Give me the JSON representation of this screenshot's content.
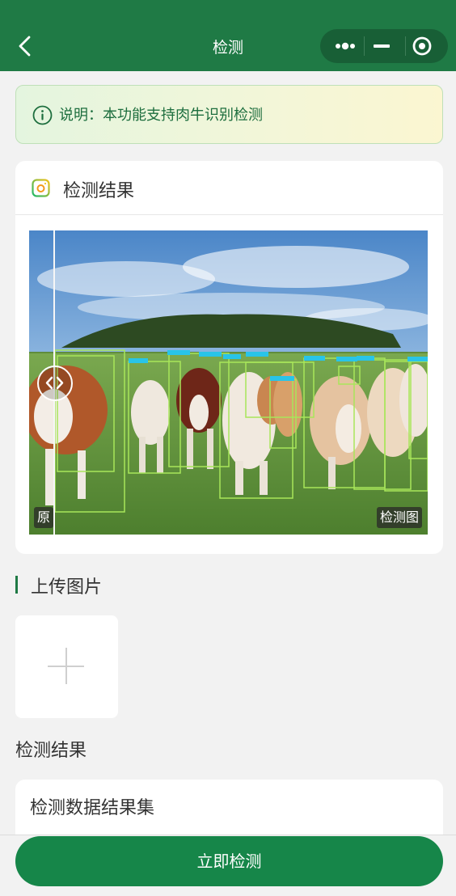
{
  "nav": {
    "title": "检测",
    "back_icon": "chevron-left-icon",
    "capsule": {
      "more_icon": "more-dots-icon",
      "minimize_icon": "minus-icon",
      "close_icon": "target-circle-icon"
    },
    "background_color": "#1f7a45"
  },
  "notice": {
    "icon": "info-circle-icon",
    "text": "说明：本功能支持肉牛识别检测"
  },
  "result": {
    "title": "检测结果",
    "icon": "camera-icon",
    "compare": {
      "original_label": "原",
      "detected_label": "检测图",
      "handle_icon": "left-right-arrows-icon"
    }
  },
  "upload": {
    "title": "上传图片",
    "add_icon": "plus-icon"
  },
  "detect_result_label": "检测结果",
  "data_card": {
    "title": "检测数据结果集"
  },
  "action": {
    "detect_button": "立即检测"
  },
  "colors": {
    "primary": "#168649",
    "accent": "#1f7a45",
    "detection_box": "#a8e65a",
    "detection_tag": "#29c4e8"
  }
}
